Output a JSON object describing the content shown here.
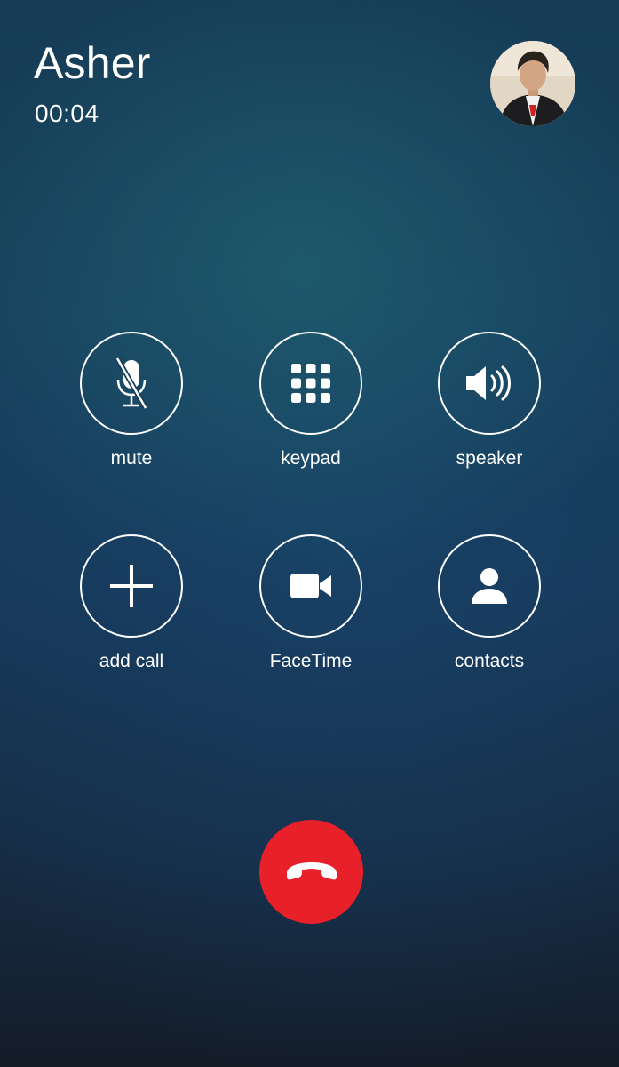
{
  "call": {
    "caller_name": "Asher",
    "timer": "00:04"
  },
  "controls": [
    {
      "label": "mute",
      "icon": "mic-slash-icon"
    },
    {
      "label": "keypad",
      "icon": "keypad-grid-icon"
    },
    {
      "label": "speaker",
      "icon": "speaker-icon"
    },
    {
      "label": "add call",
      "icon": "plus-icon"
    },
    {
      "label": "FaceTime",
      "icon": "video-camera-icon"
    },
    {
      "label": "contacts",
      "icon": "person-icon"
    }
  ],
  "end_call": {
    "icon": "phone-hangup-icon",
    "color": "#e8202a"
  },
  "colors": {
    "accent_end": "#e8202a",
    "foreground": "#ffffff"
  }
}
